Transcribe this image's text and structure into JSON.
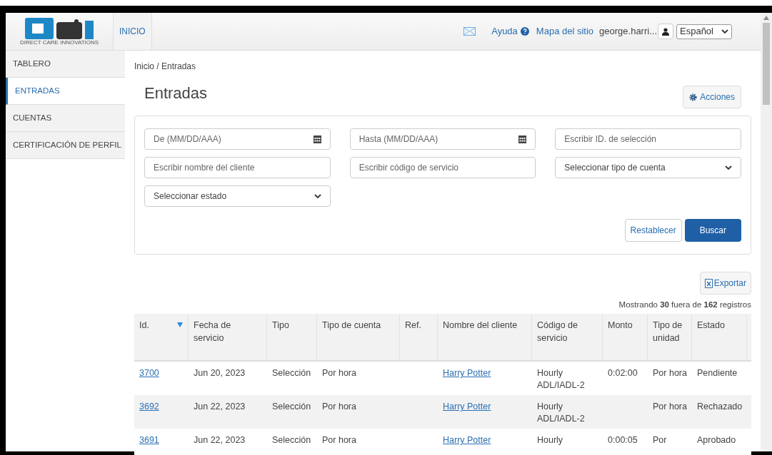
{
  "header": {
    "logo_caption": "DIRECT CARE INNOVATIONS",
    "nav_tabs": [
      {
        "label": "INICIO",
        "selected": true
      }
    ],
    "help": "Ayuda",
    "sitemap": "Mapa del sitio",
    "user": "george.harri...",
    "language": "Español"
  },
  "sidebar": {
    "items": [
      {
        "label": "TABLERO",
        "selected": false
      },
      {
        "label": "ENTRADAS",
        "selected": true
      },
      {
        "label": "CUENTAS",
        "selected": false
      },
      {
        "label": "CERTIFICACIÓN DE PERFIL",
        "selected": false
      }
    ]
  },
  "breadcrumb": "Inicio / Entradas",
  "title": "Entradas",
  "actions_button": "Acciones",
  "filters": [
    {
      "kind": "date",
      "placeholder": "De (MM/DD/AAA)"
    },
    {
      "kind": "date",
      "placeholder": "Hasta (MM/DD/AAA)"
    },
    {
      "kind": "text",
      "placeholder": "Escribir ID. de selección"
    },
    {
      "kind": "text",
      "placeholder": "Escribir nombre del cliente"
    },
    {
      "kind": "text",
      "placeholder": "Escribir código de servicio"
    },
    {
      "kind": "select",
      "placeholder": "Seleccionar tipo de cuenta"
    },
    {
      "kind": "select",
      "placeholder": "Seleccionar estado"
    }
  ],
  "reset_button": "Restablecer",
  "search_button": "Buscar",
  "export_button": "Exportar",
  "summary": "Mostrando **30** fuera de **162** registros",
  "table": {
    "columns": [
      {
        "label": "Id.",
        "sorted": true
      },
      {
        "label": "Fecha de servicio",
        "sorted": false
      },
      {
        "label": "Tipo",
        "sorted": false
      },
      {
        "label": "Tipo de cuenta",
        "sorted": false
      },
      {
        "label": "Ref.",
        "sorted": false
      },
      {
        "label": "Nombre del cliente",
        "sorted": false
      },
      {
        "label": "Código de servicio",
        "sorted": false
      },
      {
        "label": "Monto",
        "sorted": false
      },
      {
        "label": "Tipo de unidad",
        "sorted": false
      },
      {
        "label": "Estado",
        "sorted": false
      }
    ],
    "rows": [
      {
        "id": "3700",
        "date": "Jun 20, 2023",
        "type": "Selección",
        "account_type": "Por hora",
        "ref": "",
        "client": "Harry Potter",
        "service_code": "Hourly ADL/IADL-2",
        "amount": "0:02:00",
        "unit_type": "Por hora",
        "status": "Pendiente"
      },
      {
        "id": "3692",
        "date": "Jun 22, 2023",
        "type": "Selección",
        "account_type": "Por hora",
        "ref": "",
        "client": "Harry Potter",
        "service_code": "Hourly ADL/IADL-2",
        "amount": "",
        "unit_type": "Por hora",
        "status": "Rechazado"
      },
      {
        "id": "3691",
        "date": "Jun 22, 2023",
        "type": "Selección",
        "account_type": "Por hora",
        "ref": "",
        "client": "Harry Potter",
        "service_code": "Hourly",
        "amount": "0:00:05",
        "unit_type": "Por",
        "status": "Aprobado"
      }
    ]
  }
}
